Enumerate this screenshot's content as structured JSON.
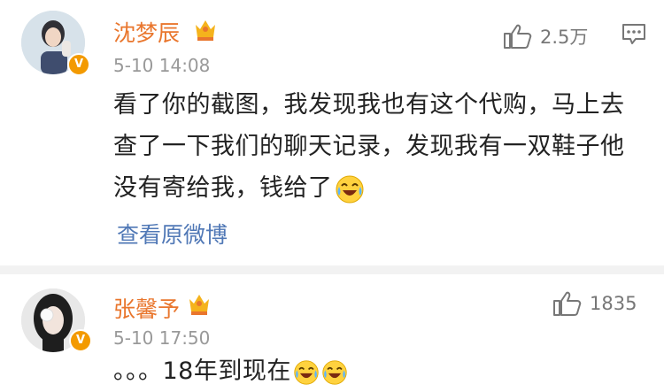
{
  "comments": [
    {
      "username": "沈梦辰",
      "time": "5-10 14:08",
      "likes": "2.5万",
      "text": "看了你的截图，我发现我也有这个代购，马上去查了一下我们的聊天记录，发现我有一双鞋子他没有寄给我，钱给了",
      "view_original": "查看原微博"
    },
    {
      "username": "张馨予",
      "time": "5-10 17:50",
      "likes": "1835",
      "text": "。。。18年到现在"
    }
  ],
  "colors": {
    "username": "#e9762d",
    "link": "#5078b6",
    "verified_badge": "#f39a00",
    "divider": "#f2f2f2"
  }
}
